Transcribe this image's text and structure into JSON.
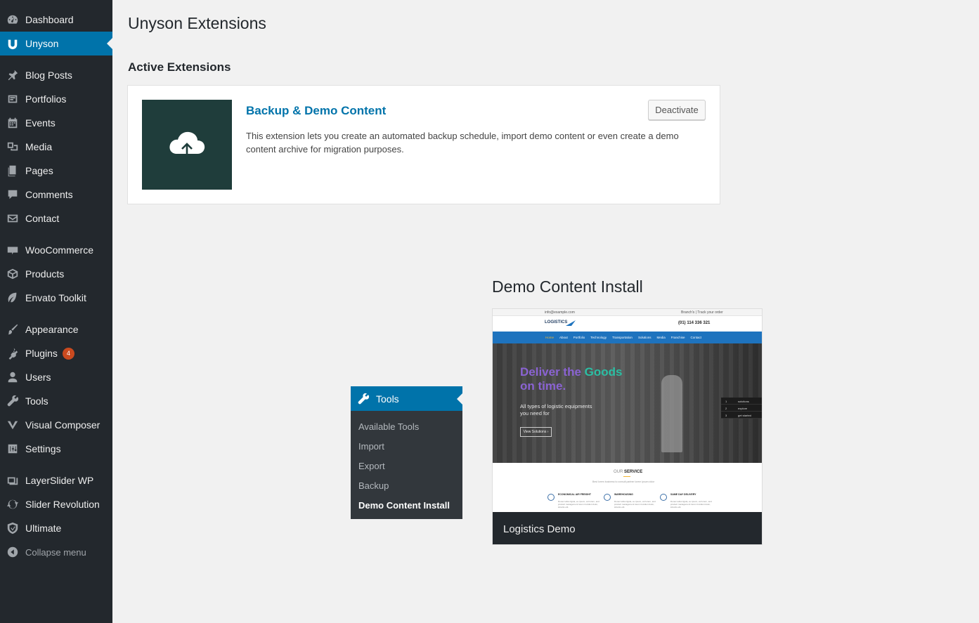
{
  "sidebar": {
    "items": [
      {
        "label": "Dashboard",
        "icon": "dashboard-icon"
      },
      {
        "label": "Unyson",
        "icon": "unyson-icon",
        "current": true
      },
      {
        "label": "Blog Posts",
        "icon": "pin-icon"
      },
      {
        "label": "Portfolios",
        "icon": "portfolio-icon"
      },
      {
        "label": "Events",
        "icon": "calendar-icon"
      },
      {
        "label": "Media",
        "icon": "media-icon"
      },
      {
        "label": "Pages",
        "icon": "pages-icon"
      },
      {
        "label": "Comments",
        "icon": "comment-icon"
      },
      {
        "label": "Contact",
        "icon": "mail-icon"
      },
      {
        "label": "WooCommerce",
        "icon": "woo-icon"
      },
      {
        "label": "Products",
        "icon": "box-icon"
      },
      {
        "label": "Envato Toolkit",
        "icon": "leaf-icon"
      },
      {
        "label": "Appearance",
        "icon": "brush-icon"
      },
      {
        "label": "Plugins",
        "icon": "plugin-icon",
        "badge": "4"
      },
      {
        "label": "Users",
        "icon": "user-icon"
      },
      {
        "label": "Tools",
        "icon": "wrench-icon"
      },
      {
        "label": "Visual Composer",
        "icon": "vc-icon"
      },
      {
        "label": "Settings",
        "icon": "settings-icon"
      },
      {
        "label": "LayerSlider WP",
        "icon": "layers-icon"
      },
      {
        "label": "Slider Revolution",
        "icon": "refresh-icon"
      },
      {
        "label": "Ultimate",
        "icon": "shield-icon"
      },
      {
        "label": "Collapse menu",
        "icon": "collapse-icon"
      }
    ]
  },
  "main": {
    "title": "Unyson Extensions",
    "section_title": "Active Extensions",
    "extension": {
      "title": "Backup & Demo Content",
      "description": "This extension lets you create an automated backup schedule, import demo content or even create a demo content archive for migration purposes.",
      "button": "Deactivate",
      "thumb_color": "#1f3d3b"
    }
  },
  "tools_menu": {
    "title": "Tools",
    "items": [
      "Available Tools",
      "Import",
      "Export",
      "Backup",
      "Demo Content Install"
    ]
  },
  "demo": {
    "title": "Demo Content Install",
    "caption": "Logistics Demo",
    "preview": {
      "topbar_left": "info@example.com",
      "topbar_right": "Branch's  |  Track your order",
      "logo": "LOGISTICS",
      "phone": "(01) 114 336 321",
      "nav": [
        "Home",
        "About",
        "Portfolio",
        "Technology",
        "Transportation",
        "Solutions",
        "Media",
        "Franchise",
        "Contact"
      ],
      "hero_line1_a": "Deliver the ",
      "hero_line1_b": "Goods",
      "hero_line2": "on time.",
      "hero_sub1": "All types of logistic equipments",
      "hero_sub2": "you need for",
      "hero_btn": "View Solutions ›",
      "side_list": [
        {
          "num": "1",
          "label": "solutions"
        },
        {
          "num": "2",
          "label": "explore"
        },
        {
          "num": "3",
          "label": "get started"
        }
      ],
      "service_title_a": "OUR ",
      "service_title_b": "SERVICE",
      "service_sub": "Best lorem business to consult partner lorem ipsum dolor",
      "services": [
        "ECONOMICAL AIR FREIGHT",
        "WAREHOUSING",
        "SAME DAY DELIVERY"
      ],
      "service_desc": "Donec tellus ligula, eu ipsum, vel lorem, and product management lorem tincidunt dolor, lobortis elit.",
      "colors": {
        "nav": "#1e73be",
        "hero_purple": "#8a63d2",
        "hero_teal": "#2bbfa4",
        "accent": "#f2b632"
      }
    }
  }
}
